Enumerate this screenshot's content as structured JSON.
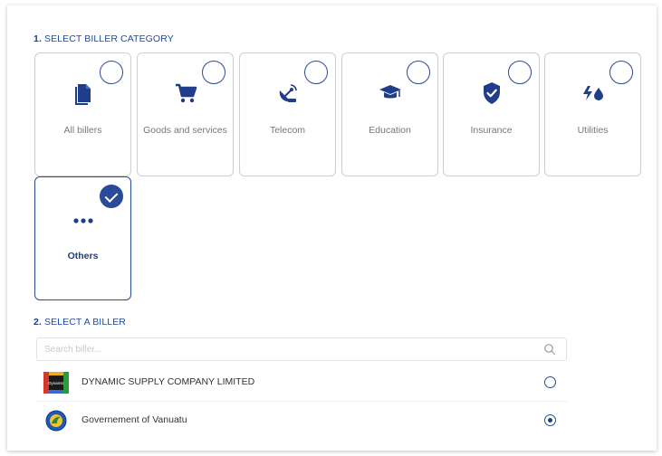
{
  "section1": {
    "number": "1.",
    "title": "SELECT BILLER CATEGORY"
  },
  "categories": [
    {
      "label": "All billers",
      "icon": "document-icon",
      "selected": false
    },
    {
      "label": "Goods and services",
      "icon": "cart-icon",
      "selected": false
    },
    {
      "label": "Telecom",
      "icon": "satellite-dish-icon",
      "selected": false
    },
    {
      "label": "Education",
      "icon": "graduation-cap-icon",
      "selected": false
    },
    {
      "label": "Insurance",
      "icon": "shield-check-icon",
      "selected": false
    },
    {
      "label": "Utilities",
      "icon": "bolt-drop-icon",
      "selected": false
    },
    {
      "label": "Others",
      "icon": "ellipsis-icon",
      "selected": true
    }
  ],
  "section2": {
    "number": "2.",
    "title": "SELECT A BILLER"
  },
  "search": {
    "placeholder": "Search biller...",
    "value": ""
  },
  "billers": [
    {
      "name": "DYNAMIC SUPPLY COMPANY LIMITED",
      "logo": "dynamic-supply-logo",
      "logo_text": "Dynamic",
      "selected": false
    },
    {
      "name": "Governement of Vanuatu",
      "logo": "vanuatu-seal-logo",
      "selected": true
    }
  ],
  "colors": {
    "accent": "#2a4a9a",
    "title": "#1f4aa8",
    "border": "#cfcfcf",
    "muted_text": "#777777"
  }
}
